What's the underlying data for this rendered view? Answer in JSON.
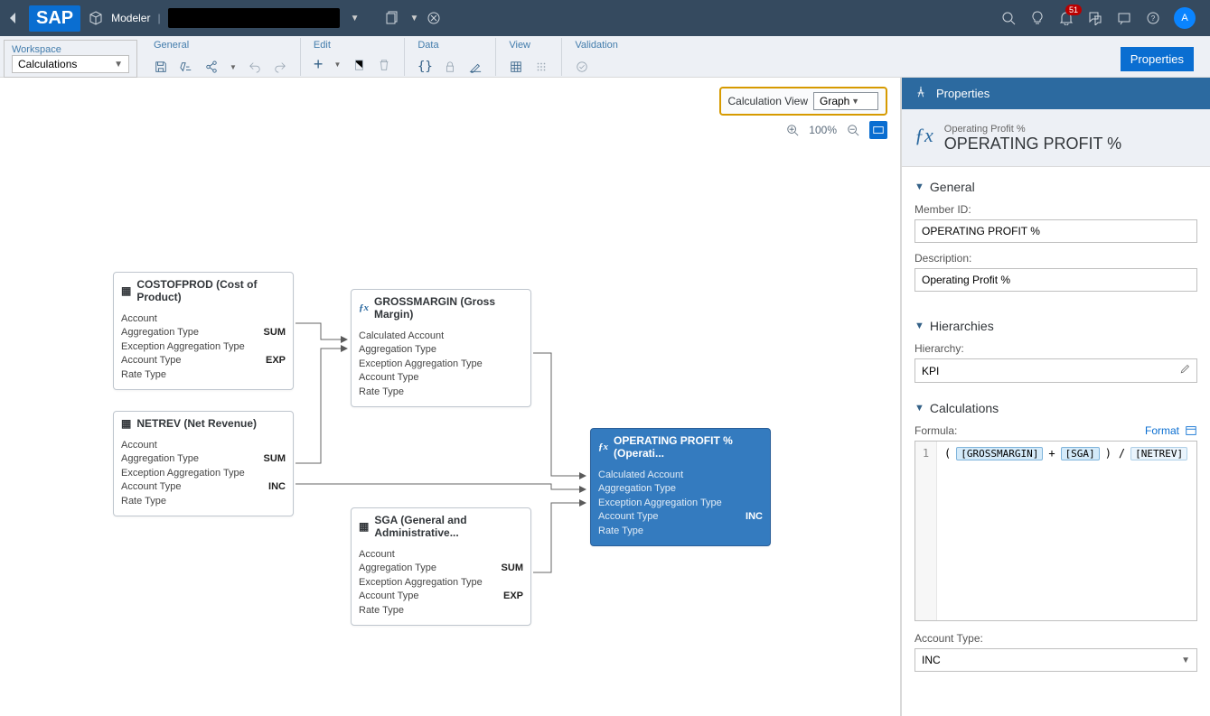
{
  "topbar": {
    "modeler_label": "Modeler",
    "notification_count": "51",
    "avatar_initial": "A"
  },
  "toolbar": {
    "workspace_label": "Workspace",
    "workspace_value": "Calculations",
    "general_label": "General",
    "edit_label": "Edit",
    "data_label": "Data",
    "view_label": "View",
    "validation_label": "Validation",
    "properties_btn": "Properties"
  },
  "calc_view": {
    "label": "Calculation View",
    "value": "Graph",
    "zoom": "100%"
  },
  "nodes": {
    "cost": {
      "title": "COSTOFPROD (Cost of Product)",
      "r1": "Account",
      "r2": "Aggregation Type",
      "r2v": "SUM",
      "r3": "Exception Aggregation Type",
      "r4": "Account Type",
      "r4v": "EXP",
      "r5": "Rate Type"
    },
    "netrev": {
      "title": "NETREV (Net Revenue)",
      "r1": "Account",
      "r2": "Aggregation Type",
      "r2v": "SUM",
      "r3": "Exception Aggregation Type",
      "r4": "Account Type",
      "r4v": "INC",
      "r5": "Rate Type"
    },
    "gross": {
      "title": "GROSSMARGIN (Gross Margin)",
      "r1": "Calculated Account",
      "r2": "Aggregation Type",
      "r3": "Exception Aggregation Type",
      "r4": "Account Type",
      "r5": "Rate Type"
    },
    "sga": {
      "title": "SGA (General and Administrative...",
      "r1": "Account",
      "r2": "Aggregation Type",
      "r2v": "SUM",
      "r3": "Exception Aggregation Type",
      "r4": "Account Type",
      "r4v": "EXP",
      "r5": "Rate Type"
    },
    "op": {
      "title": "OPERATING PROFIT % (Operati...",
      "r1": "Calculated Account",
      "r2": "Aggregation Type",
      "r3": "Exception Aggregation Type",
      "r4": "Account Type",
      "r4v": "INC",
      "r5": "Rate Type"
    }
  },
  "props": {
    "panel_title": "Properties",
    "small_title": "Operating Profit %",
    "big_title": "OPERATING PROFIT %",
    "sect_general": "General",
    "member_id_label": "Member ID:",
    "member_id_value": "OPERATING PROFIT %",
    "desc_label": "Description:",
    "desc_value": "Operating Profit %",
    "sect_hier": "Hierarchies",
    "hier_label": "Hierarchy:",
    "hier_value": "KPI",
    "sect_calc": "Calculations",
    "formula_label": "Formula:",
    "format_link": "Format",
    "line_no": "1",
    "tok1": "[GROSSMARGIN]",
    "tok2": "[SGA]",
    "tok3": "[NETREV]",
    "acct_type_label": "Account Type:",
    "acct_type_value": "INC"
  }
}
